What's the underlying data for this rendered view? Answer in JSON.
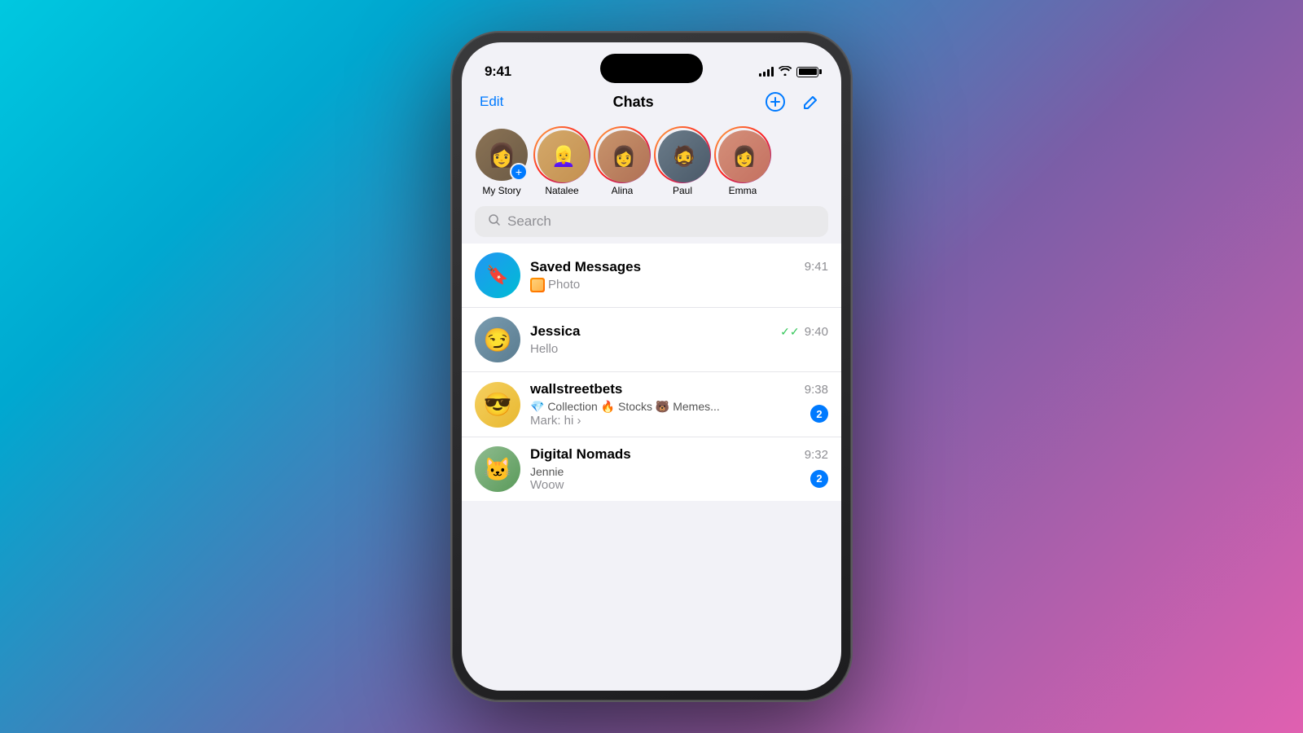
{
  "background": "gradient",
  "phone": {
    "status_bar": {
      "time": "9:41",
      "signal_bars": [
        4,
        6,
        8,
        10
      ],
      "wifi": "wifi",
      "battery": "full"
    },
    "nav": {
      "edit_label": "Edit",
      "title": "Chats",
      "add_icon": "plus-circle",
      "compose_icon": "compose"
    },
    "stories": [
      {
        "name": "My Story",
        "has_ring": false,
        "has_add": true,
        "emoji": "👩",
        "color": "#8b7355"
      },
      {
        "name": "Natalee",
        "has_ring": true,
        "emoji": "👱‍♀️",
        "color": "#c49050"
      },
      {
        "name": "Alina",
        "has_ring": true,
        "emoji": "👩",
        "color": "#b07055"
      },
      {
        "name": "Paul",
        "has_ring": true,
        "emoji": "🧔",
        "color": "#4a5968"
      },
      {
        "name": "Emma",
        "has_ring": true,
        "emoji": "👩",
        "color": "#c47060"
      }
    ],
    "search": {
      "placeholder": "Search"
    },
    "chats": [
      {
        "id": "saved",
        "name": "Saved Messages",
        "time": "9:41",
        "preview": "Photo",
        "avatar_type": "bookmark",
        "has_badge": false,
        "badge_count": 0,
        "read_status": ""
      },
      {
        "id": "jessica",
        "name": "Jessica",
        "time": "9:40",
        "preview": "Hello",
        "avatar_type": "person",
        "avatar_emoji": "😏",
        "has_badge": false,
        "badge_count": 0,
        "read_status": "read"
      },
      {
        "id": "wallstreetbets",
        "name": "wallstreetbets",
        "time": "9:38",
        "preview": "💎 Collection 🔥 Stocks 🐻 Memes...",
        "preview2": "Mark: hi",
        "avatar_type": "group",
        "avatar_emoji": "😎",
        "has_badge": true,
        "badge_count": 2,
        "read_status": ""
      },
      {
        "id": "digitalnomads",
        "name": "Digital Nomads",
        "time": "9:32",
        "preview": "Jennie",
        "preview2": "Woow",
        "avatar_type": "group",
        "avatar_emoji": "🐱",
        "has_badge": true,
        "badge_count": 2,
        "read_status": ""
      }
    ]
  }
}
